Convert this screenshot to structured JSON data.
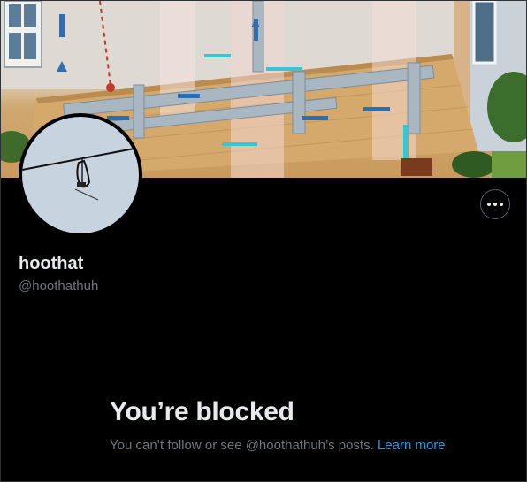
{
  "profile": {
    "display_name": "hoothat",
    "handle": "@hoothathuh",
    "banner_icon": "hvac-ductwork-illustration",
    "avatar_icon": "power-line-photo"
  },
  "actions": {
    "more_icon": "more-options-icon"
  },
  "blocked": {
    "title": "You’re blocked",
    "message": "You can’t follow or see @hoothathuh’s posts.",
    "learn_more": "Learn more"
  },
  "colors": {
    "background": "#000000",
    "text_primary": "#e7e9ea",
    "text_secondary": "#71767b",
    "link": "#1d9bf0"
  }
}
